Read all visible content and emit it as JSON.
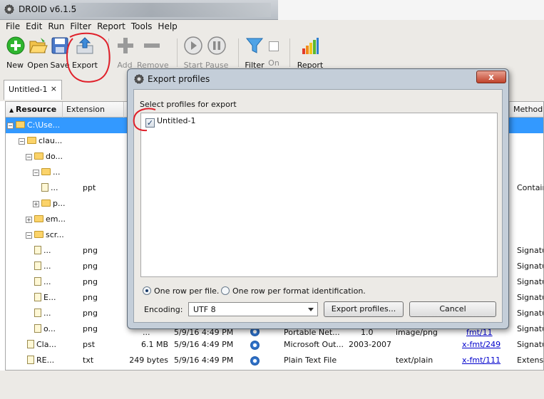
{
  "app": {
    "title": "DROID v6.1.5"
  },
  "menu": [
    "File",
    "Edit",
    "Run",
    "Filter",
    "Report",
    "Tools",
    "Help"
  ],
  "toolbar": {
    "new": "New",
    "open": "Open",
    "save": "Save",
    "export": "Export",
    "add": "Add",
    "remove": "Remove",
    "start": "Start",
    "pause": "Pause",
    "filter": "Filter",
    "on": "On",
    "report": "Report"
  },
  "tab": {
    "label": "Untitled-1",
    "close": "×"
  },
  "table": {
    "headers": {
      "resource": "Resource",
      "extension": "Extension",
      "method": "Method"
    },
    "rows": [
      {
        "name": "C:\\Use...",
        "ext": "",
        "method": ""
      },
      {
        "name": "clau...",
        "ext": "",
        "method": ""
      },
      {
        "name": "do...",
        "ext": "",
        "method": ""
      },
      {
        "name": "...",
        "ext": "",
        "method": ""
      },
      {
        "name": "...",
        "ext": "ppt",
        "method": "Containe"
      },
      {
        "name": "p...",
        "ext": "",
        "method": ""
      },
      {
        "name": "em...",
        "ext": "",
        "method": ""
      },
      {
        "name": "scr...",
        "ext": "",
        "method": ""
      },
      {
        "name": "...",
        "ext": "png",
        "method": "Signatu"
      },
      {
        "name": "...",
        "ext": "png",
        "method": "Signatu"
      },
      {
        "name": "...",
        "ext": "png",
        "method": "Signatu"
      },
      {
        "name": "E...",
        "ext": "png",
        "method": "Signatu"
      },
      {
        "name": "...",
        "ext": "png",
        "method": "Signatu"
      },
      {
        "name": "o...",
        "ext": "png",
        "method": "Signatu"
      },
      {
        "name": "Cla...",
        "ext": "pst",
        "size": "6.1 MB",
        "date": "5/9/16 4:49 PM",
        "format": "Microsoft Out...",
        "version": "2003-2007",
        "mime": "",
        "puid": "x-fmt/249",
        "method": "Signatu"
      },
      {
        "name": "RE...",
        "ext": "txt",
        "size": "249 bytes",
        "date": "5/9/16 4:49 PM",
        "format": "Plain Text File",
        "version": "",
        "mime": "text/plain",
        "puid": "x-fmt/111",
        "method": "Extensio"
      }
    ],
    "partial_row": {
      "size": "...",
      "date": "5/9/16 4:49 PM",
      "format": "Portable Net...",
      "version": "1.0",
      "mime": "image/png",
      "puid": "fmt/11"
    }
  },
  "dialog": {
    "title": "Export profiles",
    "close": "x",
    "prompt": "Select profiles for export",
    "profile": {
      "label": "Untitled-1",
      "checked": "✓"
    },
    "option_row_per_file": "One row per file.",
    "option_row_per_format": "One row per format identification.",
    "encoding_label": "Encoding:",
    "encoding_value": "UTF 8",
    "export_button": "Export profiles...",
    "cancel_button": "Cancel"
  },
  "colors": {
    "selection": "#3399ff",
    "annotation": "#e0202a",
    "dialog_frame": "#c4ced9"
  }
}
